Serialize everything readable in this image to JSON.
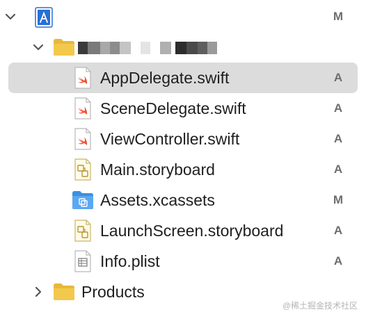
{
  "project": {
    "name": "",
    "status": "M",
    "icon": "xcode-project-icon"
  },
  "group": {
    "name": "",
    "icon": "folder-icon"
  },
  "files": [
    {
      "name": "AppDelegate.swift",
      "status": "A",
      "icon": "swift-file-icon",
      "selected": true
    },
    {
      "name": "SceneDelegate.swift",
      "status": "A",
      "icon": "swift-file-icon"
    },
    {
      "name": "ViewController.swift",
      "status": "A",
      "icon": "swift-file-icon"
    },
    {
      "name": "Main.storyboard",
      "status": "A",
      "icon": "storyboard-file-icon"
    },
    {
      "name": "Assets.xcassets",
      "status": "M",
      "icon": "asset-catalog-icon"
    },
    {
      "name": "LaunchScreen.storyboard",
      "status": "A",
      "icon": "storyboard-file-icon"
    },
    {
      "name": "Info.plist",
      "status": "A",
      "icon": "plist-file-icon"
    }
  ],
  "products": {
    "name": "Products",
    "icon": "folder-icon"
  },
  "watermark": "@稀土掘金技术社区",
  "colors": {
    "selection": "#dcdcdc",
    "folder": "#f2c94c",
    "project_blue": "#2a6fd6",
    "swift_orange": "#f05138",
    "status_gray": "#6e6e6e"
  }
}
